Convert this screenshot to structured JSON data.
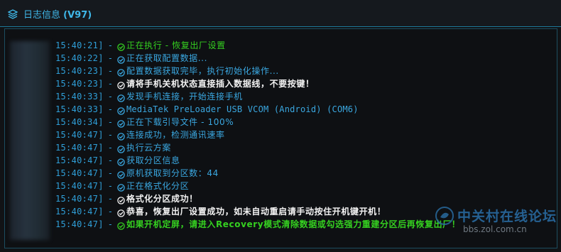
{
  "header": {
    "title": "日志信息",
    "version": "(V97)",
    "icon": "layers-icon"
  },
  "colors": {
    "accent": "#3fb7e8",
    "timestamp": "#2f9fd8",
    "success": "#35d020",
    "info": "#3aa7e0",
    "warning": "#f2f2f2"
  },
  "log": [
    {
      "time": "15:40:21]",
      "sep": "-",
      "icon": "check-circle-icon",
      "text": "正在执行 - 恢复出厂设置",
      "level": "green"
    },
    {
      "time": "15:40:22]",
      "sep": "-",
      "icon": "check-circle-icon",
      "text": "正在获取配置数据...",
      "level": "blue"
    },
    {
      "time": "15:40:23]",
      "sep": "-",
      "icon": "check-circle-icon",
      "text": "配置数据获取完毕，执行初始化操作...",
      "level": "blue"
    },
    {
      "time": "15:40:23]",
      "sep": "-",
      "icon": "check-circle-icon",
      "text": "请将手机关机状态直接插入数据线，不要按键！",
      "level": "white"
    },
    {
      "time": "15:40:33]",
      "sep": "-",
      "icon": "check-circle-icon",
      "text": "发现手机连接，开始连接手机",
      "level": "blue"
    },
    {
      "time": "15:40:33]",
      "sep": "-",
      "icon": "check-circle-icon",
      "text": "MediaTek PreLoader USB VCOM (Android) (COM6)",
      "level": "blue-mono"
    },
    {
      "time": "15:40:34]",
      "sep": "-",
      "icon": "check-circle-icon",
      "text": "正在下载引导文件 - 100%",
      "level": "blue"
    },
    {
      "time": "15:40:47]",
      "sep": "-",
      "icon": "check-circle-icon",
      "text": "连接成功，检测通讯速率",
      "level": "blue"
    },
    {
      "time": "15:40:47]",
      "sep": "-",
      "icon": "check-circle-icon",
      "text": "执行云方案",
      "level": "blue"
    },
    {
      "time": "15:40:47]",
      "sep": "-",
      "icon": "check-circle-icon",
      "text": "获取分区信息",
      "level": "blue"
    },
    {
      "time": "15:40:47]",
      "sep": "-",
      "icon": "check-circle-icon",
      "text": "原机获取到分区数：44",
      "level": "blue"
    },
    {
      "time": "15:40:47]",
      "sep": "-",
      "icon": "check-circle-icon",
      "text": "正在格式化分区",
      "level": "blue"
    },
    {
      "time": "15:40:47]",
      "sep": "-",
      "icon": "check-circle-icon",
      "text": "格式化分区成功！",
      "level": "white"
    },
    {
      "time": "15:40:47]",
      "sep": "-",
      "icon": "check-circle-icon",
      "text": "恭喜，恢复出厂设置成功，如未自动重启请手动按住开机键开机！",
      "level": "white"
    },
    {
      "time": "15:40:47]",
      "sep": "-",
      "icon": "check-circle-icon",
      "text": "如果开机定屏，请进入Recovery模式清除数据或勾选强力重建分区后再恢复出厂！",
      "level": "green-b"
    }
  ],
  "watermark": {
    "site_name": "中关村在线论坛",
    "url": "bbs.zol.com.cn",
    "icon": "zol-logo-icon"
  }
}
